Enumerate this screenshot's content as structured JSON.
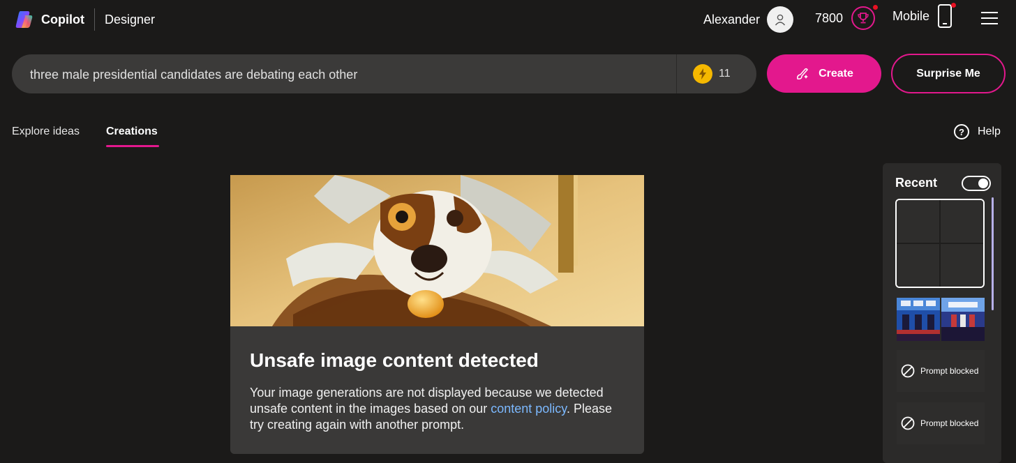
{
  "header": {
    "app_name": "Copilot",
    "app_sub": "Designer",
    "user_name": "Alexander",
    "points": "7800",
    "mobile_label": "Mobile"
  },
  "search": {
    "value": "three male presidential candidates are debating each other",
    "boost_count": "11"
  },
  "actions": {
    "create_label": "Create",
    "surprise_label": "Surprise Me"
  },
  "tabs": [
    {
      "label": "Explore ideas",
      "active": false
    },
    {
      "label": "Creations",
      "active": true
    }
  ],
  "help_label": "Help",
  "card": {
    "title": "Unsafe image content detected",
    "body_before": "Your image generations are not displayed because we detected unsafe content in the images based on our ",
    "link_text": "content policy",
    "body_after": ". Please try creating again with another prompt."
  },
  "recent": {
    "title": "Recent",
    "toggle_on": true,
    "blocked_items": [
      {
        "label": "Prompt blocked"
      },
      {
        "label": "Prompt blocked"
      }
    ]
  },
  "colors": {
    "accent": "#e3188d",
    "background": "#1b1a19",
    "link": "#7cb9ff",
    "boost": "#f5b800"
  }
}
